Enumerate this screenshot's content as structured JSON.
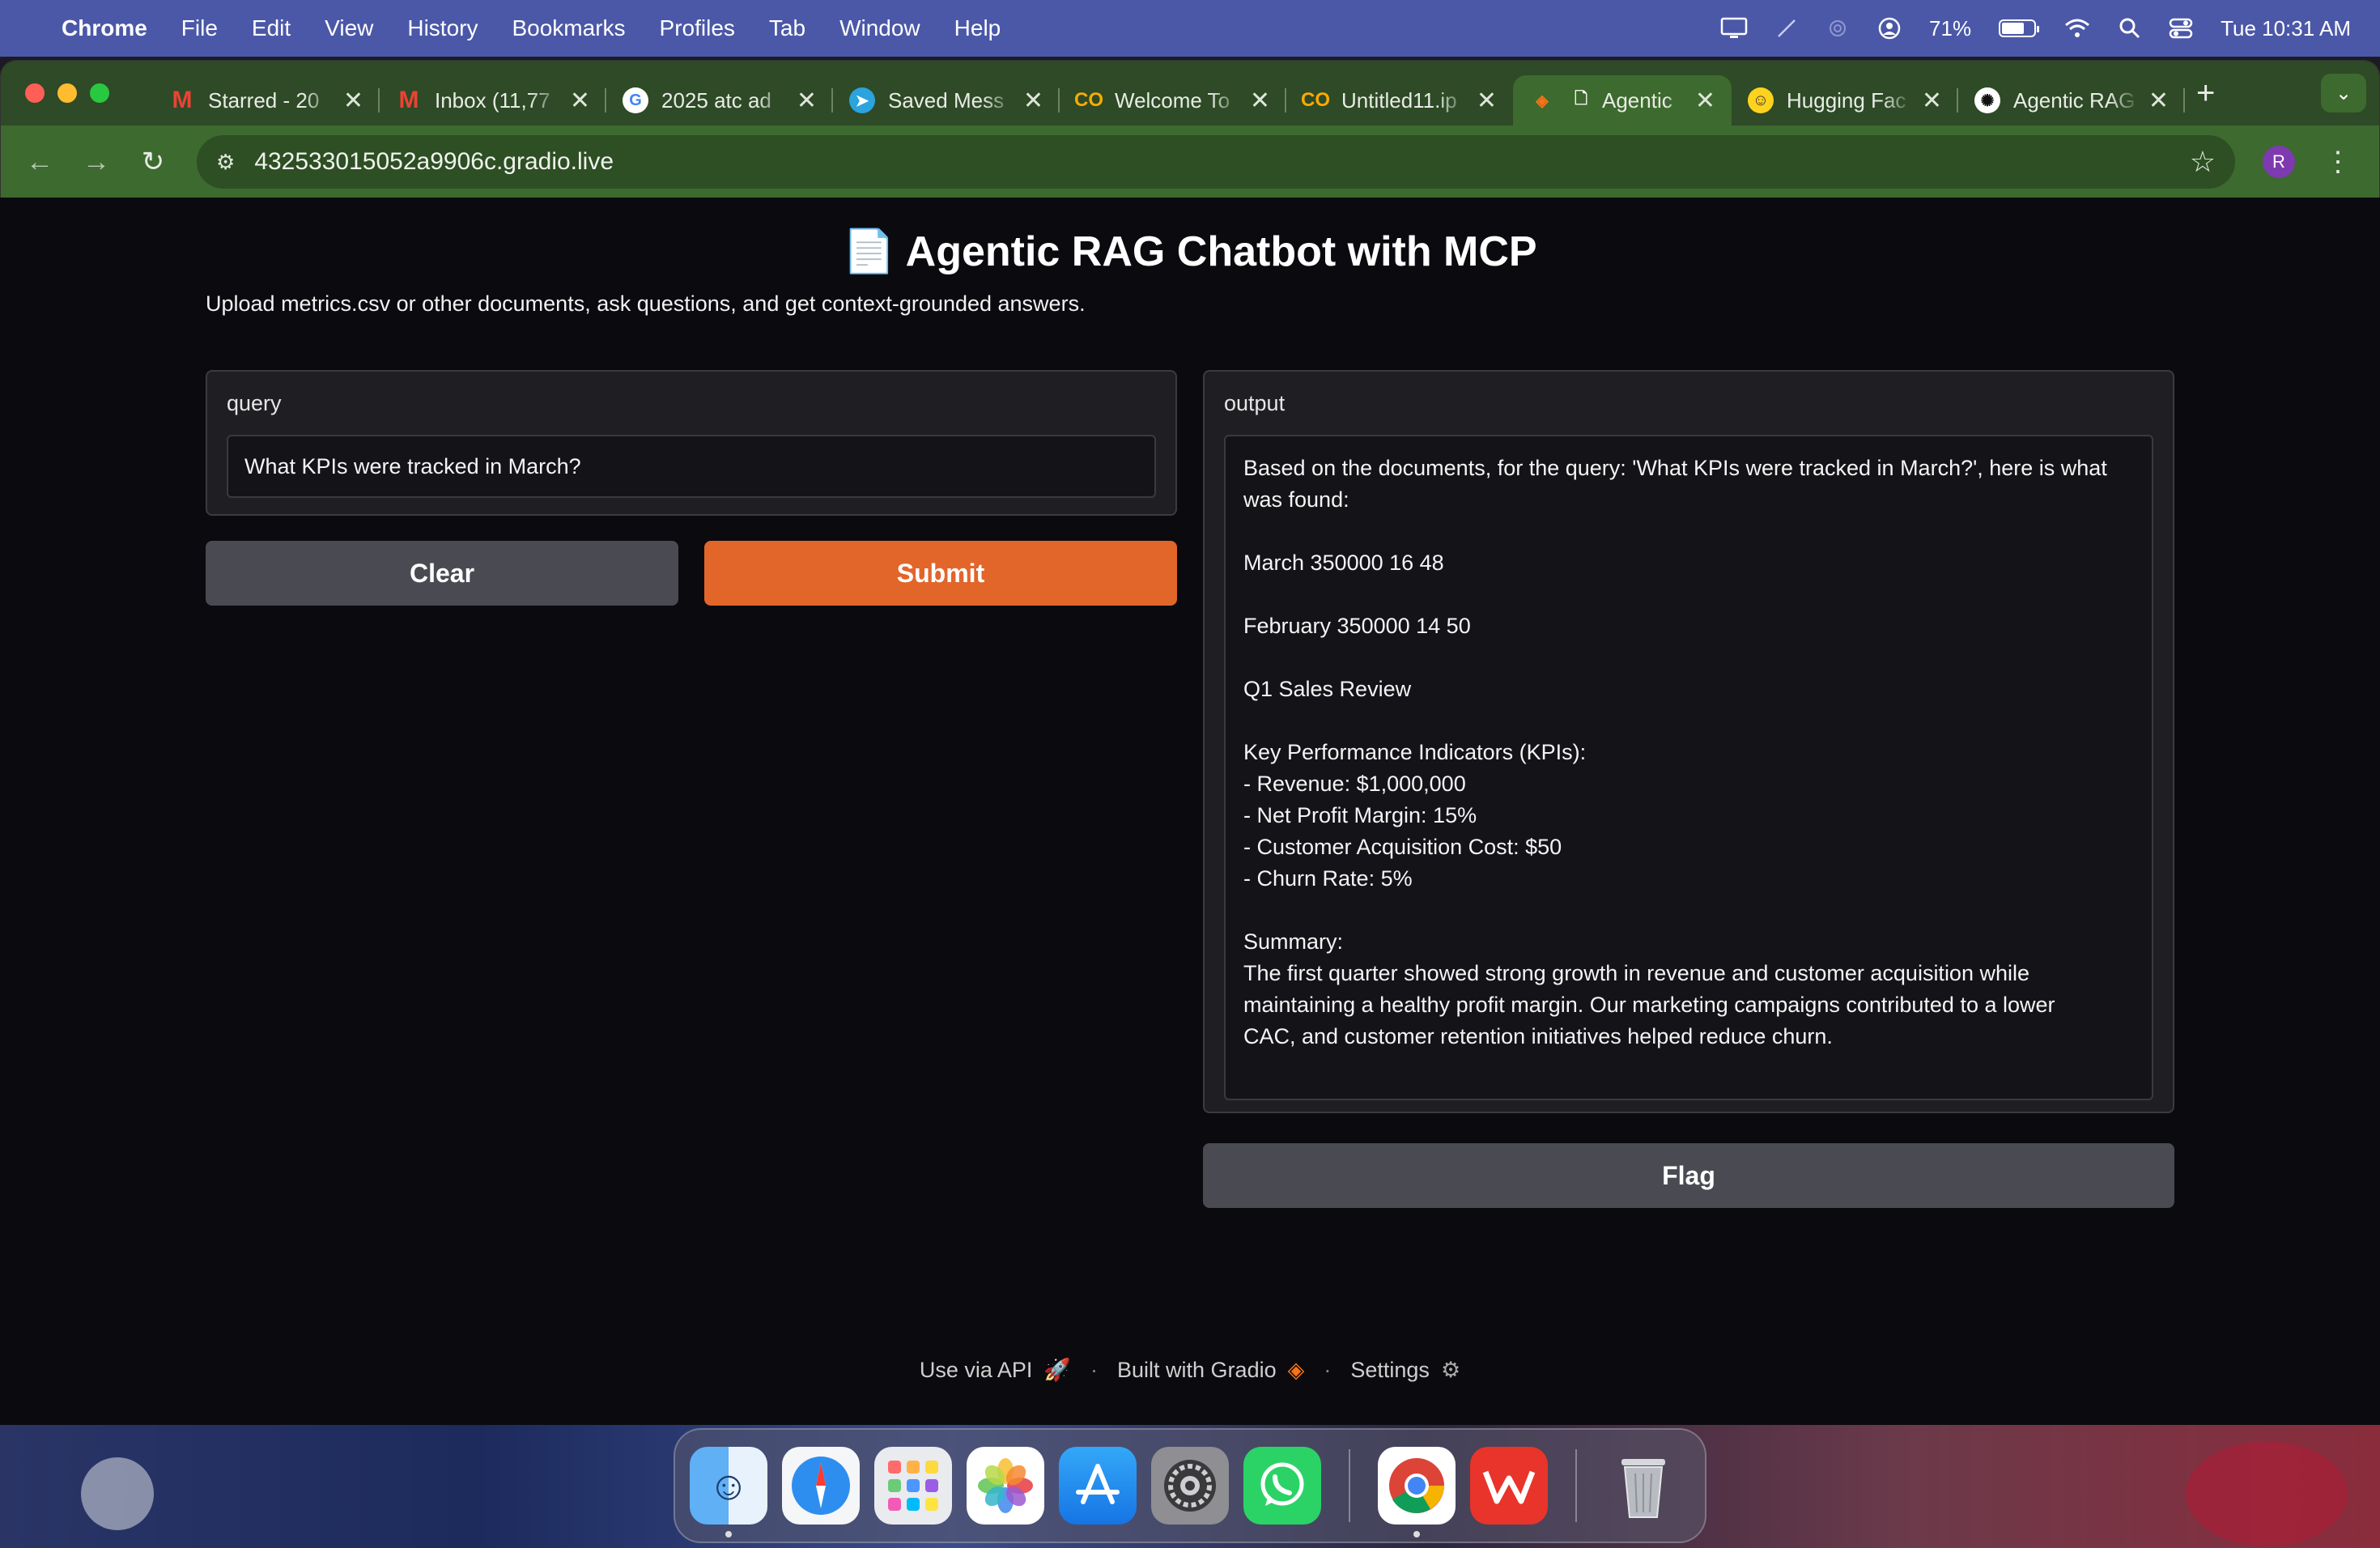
{
  "menubar": {
    "app": "Chrome",
    "items": [
      "File",
      "Edit",
      "View",
      "History",
      "Bookmarks",
      "Profiles",
      "Tab",
      "Window",
      "Help"
    ],
    "battery": "71%",
    "battery_level": 0.71,
    "clock": "Tue 10:31 AM"
  },
  "tabs": [
    {
      "title": "Starred - 20",
      "icon": "gmail-icon",
      "active": false
    },
    {
      "title": "Inbox (11,77",
      "icon": "gmail-icon",
      "active": false
    },
    {
      "title": "2025 atc ad",
      "icon": "google-icon",
      "active": false
    },
    {
      "title": "Saved Mess",
      "icon": "telegram-icon",
      "active": false
    },
    {
      "title": "Welcome To",
      "icon": "colab-icon",
      "active": false
    },
    {
      "title": "Untitled11.ip",
      "icon": "colab-icon",
      "active": false
    },
    {
      "title": "Agentic",
      "icon": "gradio-icon",
      "active": true
    },
    {
      "title": "Hugging Fac",
      "icon": "huggingface-icon",
      "active": false
    },
    {
      "title": "Agentic RAG",
      "icon": "openai-icon",
      "active": false
    }
  ],
  "address_bar": {
    "url": "432533015052a9906c.gradio.live"
  },
  "profile_initial": "R",
  "page": {
    "title": "📄 Agentic RAG Chatbot with MCP",
    "description": "Upload metrics.csv or other documents, ask questions, and get context-grounded answers.",
    "query_label": "query",
    "query_value": "What KPIs were tracked in March?",
    "clear_label": "Clear",
    "submit_label": "Submit",
    "output_label": "output",
    "output_text": "Based on the documents, for the query: 'What KPIs were tracked in March?', here is what was found:\n\nMarch 350000 16 48\n\nFebruary 350000 14 50\n\nQ1 Sales Review\n\nKey Performance Indicators (KPIs):\n- Revenue: $1,000,000\n- Net Profit Margin: 15%\n- Customer Acquisition Cost: $50\n- Churn Rate: 5%\n\nSummary:\nThe first quarter showed strong growth in revenue and customer acquisition while\nmaintaining a healthy profit margin. Our marketing campaigns contributed to a lower\nCAC, and customer retention initiatives helped reduce churn.",
    "flag_label": "Flag"
  },
  "footer": {
    "api": "Use via API",
    "built": "Built with Gradio",
    "settings": "Settings"
  },
  "colors": {
    "accent": "#e2652a",
    "chrome_theme": "#3d6a2e",
    "menubar": "#4b58a8"
  },
  "dock": [
    "finder-icon",
    "safari-icon",
    "launchpad-icon",
    "photos-icon",
    "app-store-icon",
    "system-settings-icon",
    "whatsapp-icon",
    "chrome-icon",
    "wps-office-icon",
    "trash-icon"
  ]
}
